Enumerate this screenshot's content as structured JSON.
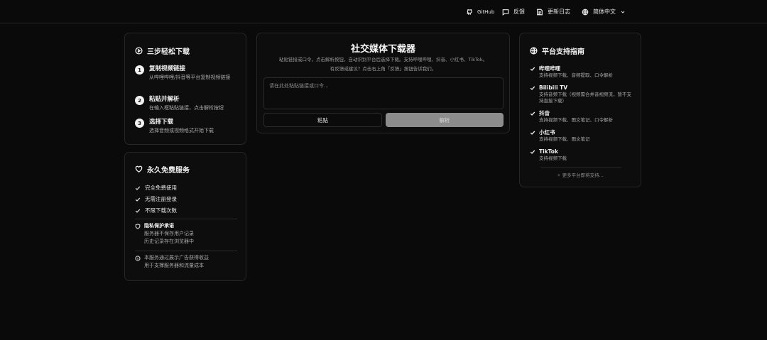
{
  "topbar": {
    "github": "GitHub",
    "feedback": "反馈",
    "changelog": "更新日志",
    "language": "简体中文"
  },
  "steps_card": {
    "title": "三步轻松下载",
    "steps": [
      {
        "num": "1",
        "title": "复制视频链接",
        "desc": "从哔哩哔哩/抖音等平台复制视频链接"
      },
      {
        "num": "2",
        "title": "粘贴并解析",
        "desc": "在输入框粘贴链接，点击解析按钮"
      },
      {
        "num": "3",
        "title": "选择下载",
        "desc": "选择音频或视频格式开始下载"
      }
    ]
  },
  "free_card": {
    "title": "永久免费服务",
    "checks": [
      "完全免费使用",
      "无需注册登录",
      "不限下载次数"
    ],
    "privacy": {
      "title": "隐私保护承诺",
      "lines": [
        "服务器不保存用户记录",
        "历史记录存在浏览器中"
      ]
    },
    "ad_note": {
      "lines": [
        "本服务通过展示广告获得收益",
        "用于支撑服务器和流量成本"
      ]
    }
  },
  "main": {
    "title": "社交媒体下载器",
    "desc_line1": "粘贴链接或口令，点击解析按钮，自动识别平台后选择下载。支持哔哩哔哩、抖音、小红书、TikTok。",
    "desc_line2": "有反馈或建议？点击右上角「反馈」按钮告诉我们。",
    "input_placeholder": "请在此处粘贴链接或口令...",
    "paste_label": "粘贴",
    "parse_label": "解析"
  },
  "platform_card": {
    "title": "平台支持指南",
    "platforms": [
      {
        "name": "哔哩哔哩",
        "desc": "支持视频下载、音频提取、口令解析"
      },
      {
        "name": "Bilibili TV",
        "desc": "支持音频下载（视频需合并音视频流，暂不支持直接下载）"
      },
      {
        "name": "抖音",
        "desc": "支持视频下载、图文笔记、口令解析"
      },
      {
        "name": "小红书",
        "desc": "支持视频下载、图文笔记"
      },
      {
        "name": "TikTok",
        "desc": "支持视频下载"
      }
    ],
    "more": "更多平台即将支持..."
  },
  "colors": {
    "background": "#0a0a0a",
    "card": "#0d0d0d",
    "border": "#262626",
    "parse_button": "#8c8c8c"
  }
}
